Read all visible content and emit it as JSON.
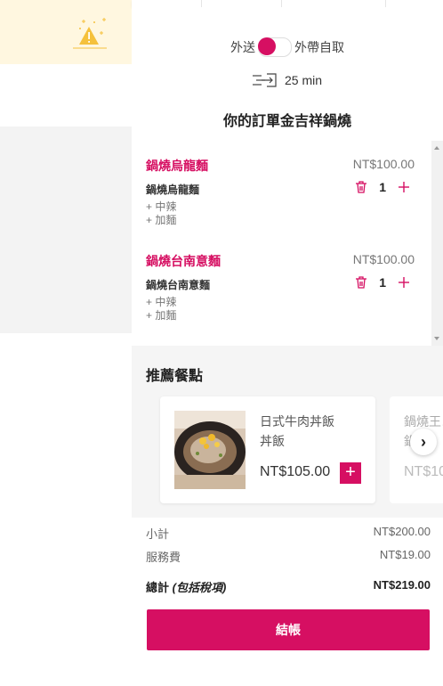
{
  "delivery_mode": {
    "left": "外送",
    "right": "外帶自取"
  },
  "eta": {
    "text": "25 min"
  },
  "order_title": "你的訂單金吉祥鍋燒",
  "cart_items": [
    {
      "name": "鍋燒烏龍麵",
      "price": "NT$100.00",
      "sub": "鍋燒烏龍麵",
      "options": [
        "+ 中辣",
        "+ 加麵"
      ],
      "qty": "1"
    },
    {
      "name": "鍋燒台南意麵",
      "price": "NT$100.00",
      "sub": "鍋燒台南意麵",
      "options": [
        "+ 中辣",
        "+ 加麵"
      ],
      "qty": "1"
    }
  ],
  "recommend": {
    "title": "推薦餐點",
    "cards": [
      {
        "name": "日式牛肉丼飯",
        "category": "丼飯",
        "price": "NT$105.00",
        "add": "+"
      },
      {
        "name": "鍋燒王…",
        "category": "鍋…",
        "price": "NT$10…"
      }
    ],
    "next": "›"
  },
  "summary": {
    "subtotal_label": "小計",
    "subtotal_value": "NT$200.00",
    "service_label": "服務費",
    "service_value": "NT$19.00",
    "total_label": "總計",
    "total_note": "(包括稅項)",
    "total_value": "NT$219.00"
  },
  "checkout_label": "結帳",
  "colors": {
    "accent": "#d60f62",
    "banner": "#fff7e0",
    "warning": "#f5c13c"
  }
}
